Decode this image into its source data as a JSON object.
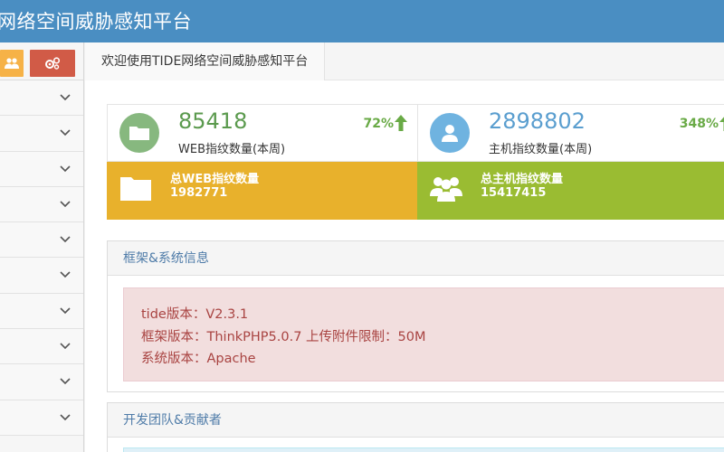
{
  "header": {
    "title": "网络空间威胁感知平台"
  },
  "sidebar": {
    "shortcuts": [
      {
        "icon": "users-icon",
        "color": "#f6b247"
      },
      {
        "icon": "cogs-icon",
        "color": "#d15b47"
      }
    ],
    "menu_count": 10
  },
  "breadcrumb": {
    "current": "欢迎使用TIDE网络空间威胁感知平台"
  },
  "stats": {
    "web": {
      "count": "85418",
      "label": "WEB指纹数量(本周)",
      "percent": "72%",
      "trend": "up"
    },
    "host": {
      "count": "2898802",
      "label": "主机指纹数量(本周)",
      "percent": "348%",
      "trend": "up"
    },
    "web_total": {
      "title": "总WEB指纹数量",
      "value": "1982771"
    },
    "host_total": {
      "title": "总主机指纹数量",
      "value": "15417415"
    }
  },
  "panels": {
    "system": {
      "title": "框架&系统信息",
      "lines": [
        "tide版本：V2.3.1",
        "框架版本：ThinkPHP5.0.7  上传附件限制：50M",
        "系统版本：Apache"
      ]
    },
    "team": {
      "title": "开发团队&贡献者"
    }
  },
  "colors": {
    "header": "#4a8ec2",
    "green": "#87b87f",
    "blue": "#6fb3e0",
    "orange": "#e8b12c",
    "olive": "#9abc32",
    "alert_bg": "#f2dede",
    "alert_text": "#a94442"
  }
}
